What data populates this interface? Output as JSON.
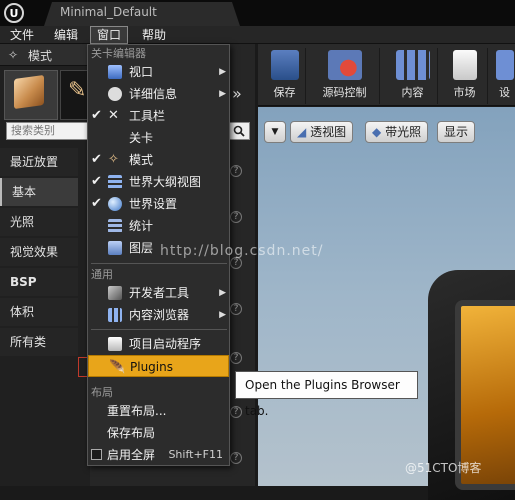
{
  "window": {
    "title": "Minimal_Default"
  },
  "menubar": {
    "items": [
      "文件",
      "编辑",
      "窗口",
      "帮助"
    ]
  },
  "modes": {
    "title": "模式",
    "search_placeholder": "搜索类别",
    "categories": [
      "最近放置",
      "基本",
      "光照",
      "视觉效果",
      "BSP",
      "体积",
      "所有类"
    ],
    "selected": "基本"
  },
  "toolbar": {
    "buttons": [
      "保存",
      "源码控制",
      "内容",
      "市场",
      "设"
    ]
  },
  "viewport": {
    "buttons": [
      "透视图",
      "带光照",
      "显示"
    ]
  },
  "dropdown": {
    "section_level": "关卡编辑器",
    "level_items": [
      {
        "label": "视口",
        "checked": false,
        "submenu": true
      },
      {
        "label": "详细信息",
        "checked": false,
        "submenu": true
      },
      {
        "label": "工具栏",
        "checked": true,
        "submenu": false
      },
      {
        "label": "关卡",
        "checked": false,
        "submenu": false
      },
      {
        "label": "模式",
        "checked": true,
        "submenu": false
      },
      {
        "label": "世界大纲视图",
        "checked": true,
        "submenu": false
      },
      {
        "label": "世界设置",
        "checked": true,
        "submenu": false
      },
      {
        "label": "统计",
        "checked": false,
        "submenu": false
      },
      {
        "label": "图层",
        "checked": false,
        "submenu": false
      }
    ],
    "section_general": "通用",
    "general_items": [
      {
        "label": "开发者工具",
        "submenu": true
      },
      {
        "label": "内容浏览器",
        "submenu": true
      },
      {
        "label": "项目启动程序",
        "submenu": false
      },
      {
        "label": "Plugins",
        "submenu": false,
        "highlighted": true
      }
    ],
    "section_layout": "布局",
    "layout_items": [
      {
        "label": "重置布局..."
      },
      {
        "label": "保存布局"
      },
      {
        "label": "启用全屏",
        "shortcut": "Shift+F11",
        "checkbox": false
      }
    ]
  },
  "tooltip": {
    "text": "Open the Plugins Browser tab."
  },
  "watermark": {
    "text": "http://blog.csdn.net/",
    "corner": "@51CTO博客"
  },
  "colors": {
    "highlight": "#e8a51a",
    "menu_bg": "#2c2c2c",
    "viewport_sky": "#9fb6c9"
  }
}
